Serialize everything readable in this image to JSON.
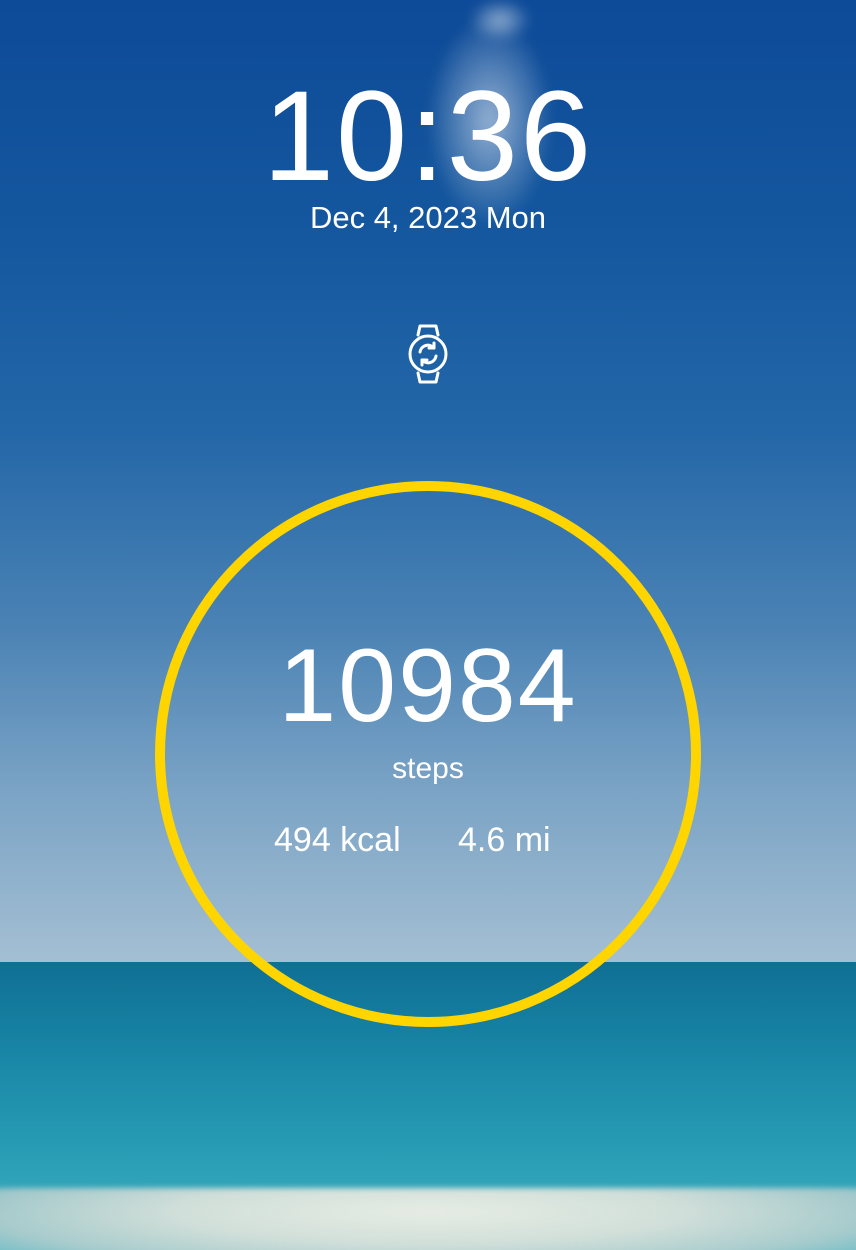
{
  "lock_screen": {
    "time": "10:36",
    "date": "Dec 4, 2023 Mon",
    "sync_icon": "watch-sync-icon"
  },
  "activity": {
    "steps": "10984",
    "steps_label": "steps",
    "calories": "494 kcal",
    "distance": "4.6 mi",
    "ring_color": "#ffd500"
  },
  "colors": {
    "sky_top": "#0d4a98",
    "sea": "#1a88a8",
    "text": "#ffffff"
  }
}
